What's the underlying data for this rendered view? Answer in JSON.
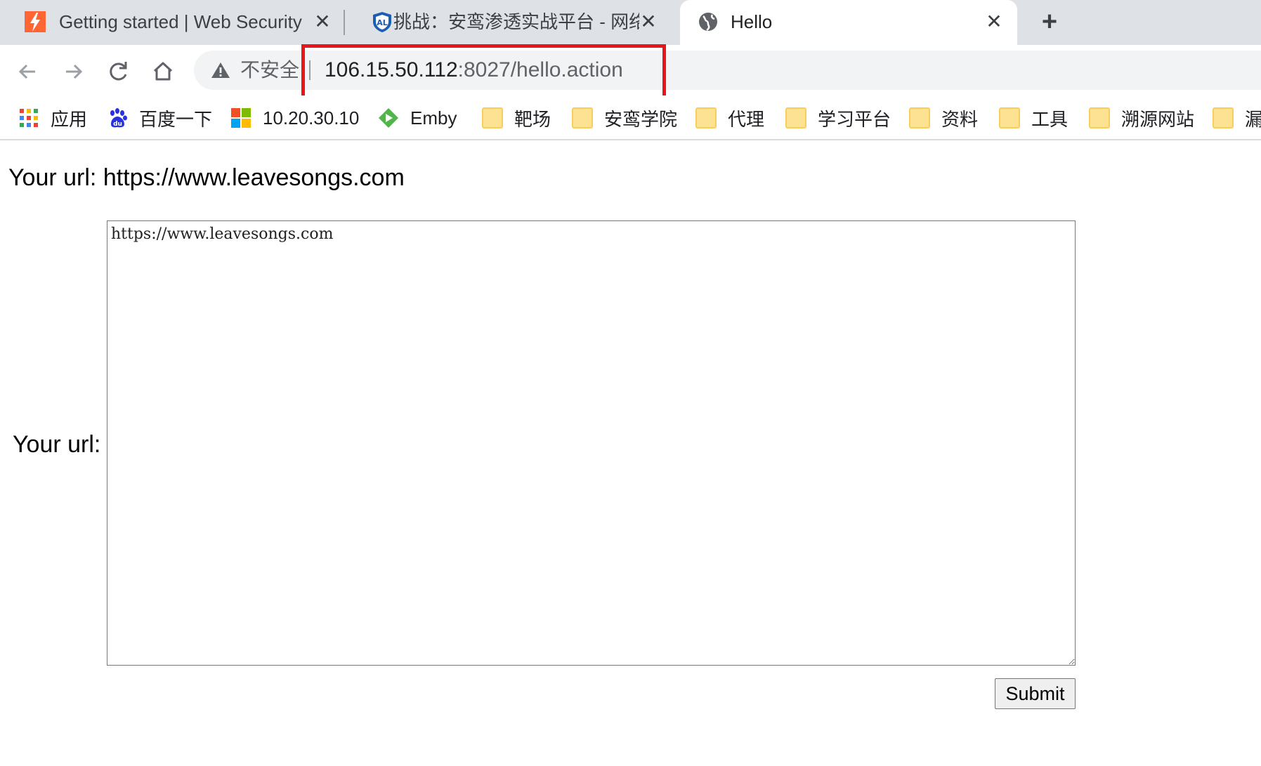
{
  "tabs": [
    {
      "title": "Getting started | Web Security",
      "favicon": "lightning-bolt-icon",
      "close": "✕"
    },
    {
      "title": "挑战：安鸾渗透实战平台 - 网络安",
      "favicon": "shield-icon",
      "close": "✕"
    },
    {
      "title": "Hello",
      "favicon": "globe-icon",
      "close": "✕"
    }
  ],
  "new_tab": "+",
  "toolbar": {
    "back_icon": "arrow-left-icon",
    "forward_icon": "arrow-right-icon",
    "reload_icon": "reload-icon",
    "home_icon": "home-icon"
  },
  "omnibox": {
    "security_label": "不安全",
    "url_host": "106.15.50.112",
    "url_path": ":8027/hello.action",
    "highlight_color": "#e8151b"
  },
  "bookmarks": [
    {
      "label": "应用",
      "icon": "apps-grid-icon"
    },
    {
      "label": "百度一下",
      "icon": "baidu-paw-icon"
    },
    {
      "label": "10.20.30.10",
      "icon": "windows-logo-icon"
    },
    {
      "label": "Emby",
      "icon": "emby-play-icon"
    },
    {
      "label": "靶场",
      "icon": "folder-icon"
    },
    {
      "label": "安鸾学院",
      "icon": "folder-icon"
    },
    {
      "label": "代理",
      "icon": "folder-icon"
    },
    {
      "label": "学习平台",
      "icon": "folder-icon"
    },
    {
      "label": "资料",
      "icon": "folder-icon"
    },
    {
      "label": "工具",
      "icon": "folder-icon"
    },
    {
      "label": "溯源网站",
      "icon": "folder-icon"
    },
    {
      "label": "漏",
      "icon": "folder-icon"
    }
  ],
  "page": {
    "heading": "Your url: https://www.leavesongs.com",
    "form_label": "Your url:",
    "textarea_value": "https://www.leavesongs.com",
    "submit_label": "Submit"
  }
}
